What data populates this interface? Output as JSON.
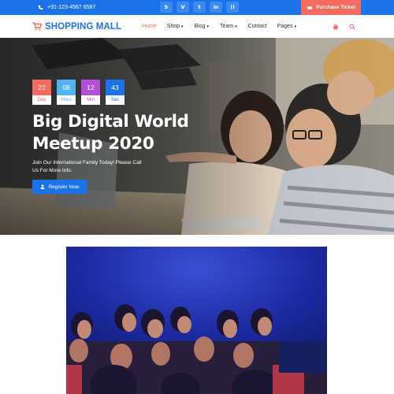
{
  "topbar": {
    "phone": "+91-123-4567 6587",
    "socials": [
      {
        "icon": "skype-icon",
        "glyph": "S"
      },
      {
        "icon": "vimeo-icon",
        "glyph": "V"
      },
      {
        "icon": "twitter-icon",
        "glyph": "t"
      },
      {
        "icon": "linkedin-icon",
        "glyph": "in"
      },
      {
        "icon": "rss-icon",
        "glyph": "))"
      }
    ],
    "ticket_label": "Purchase Ticket"
  },
  "nav": {
    "logo_text": "SHOPPING MALL",
    "menu": [
      {
        "label": "Home",
        "dropdown": false,
        "active": true
      },
      {
        "label": "Shop",
        "dropdown": true,
        "active": false
      },
      {
        "label": "Blog",
        "dropdown": true,
        "active": false
      },
      {
        "label": "Team",
        "dropdown": true,
        "active": false
      },
      {
        "label": "Contact",
        "dropdown": false,
        "active": false
      },
      {
        "label": "Pages",
        "dropdown": true,
        "active": false
      }
    ]
  },
  "hero": {
    "countdown": [
      {
        "value": "22",
        "label": "Day",
        "color": "#f66b5d"
      },
      {
        "value": "08",
        "label": "Hour",
        "color": "#4fb3f5"
      },
      {
        "value": "12",
        "label": "Min",
        "color": "#b34fd8"
      },
      {
        "value": "43",
        "label": "Sec",
        "color": "#1a73e8"
      }
    ],
    "headline_line1": "Big Digital World",
    "headline_line2": "Meetup 2020",
    "subtext": "Join Our International Family Today! Please Call Us For More Info.",
    "register_label": "Register Now"
  },
  "colors": {
    "primary": "#1a73e8",
    "accent": "#f66b5d"
  }
}
